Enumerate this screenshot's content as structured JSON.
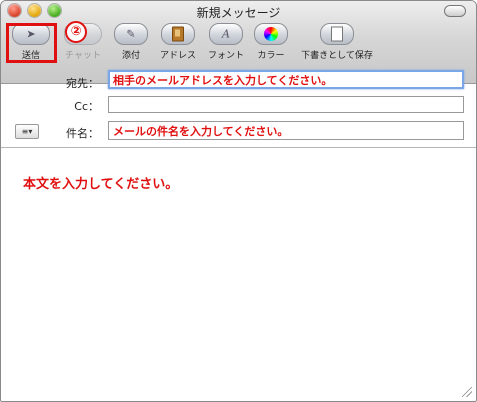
{
  "window": {
    "title": "新規メッセージ"
  },
  "toolbar": {
    "items": [
      {
        "label": "送信",
        "icon": "send-icon",
        "enabled": true
      },
      {
        "label": "チャット",
        "icon": "chat-icon",
        "enabled": false
      },
      {
        "label": "添付",
        "icon": "paperclip-icon",
        "enabled": true
      },
      {
        "label": "アドレス",
        "icon": "address-book-icon",
        "enabled": true
      },
      {
        "label": "フォント",
        "icon": "font-icon",
        "enabled": true
      },
      {
        "label": "カラー",
        "icon": "color-wheel-icon",
        "enabled": true
      },
      {
        "label": "下書きとして保存",
        "icon": "save-draft-icon",
        "enabled": true
      }
    ]
  },
  "annotation": {
    "step": "②",
    "accent_color": "#e01010"
  },
  "fields": {
    "to": {
      "label": "宛先：",
      "value": "相手のメールアドレスを入力してください。"
    },
    "cc": {
      "label": "Cc：",
      "value": ""
    },
    "subject": {
      "label": "件名：",
      "value": "メールの件名を入力してください。"
    },
    "options_menu": "≡▾"
  },
  "body": {
    "text": "本文を入力してください。"
  }
}
